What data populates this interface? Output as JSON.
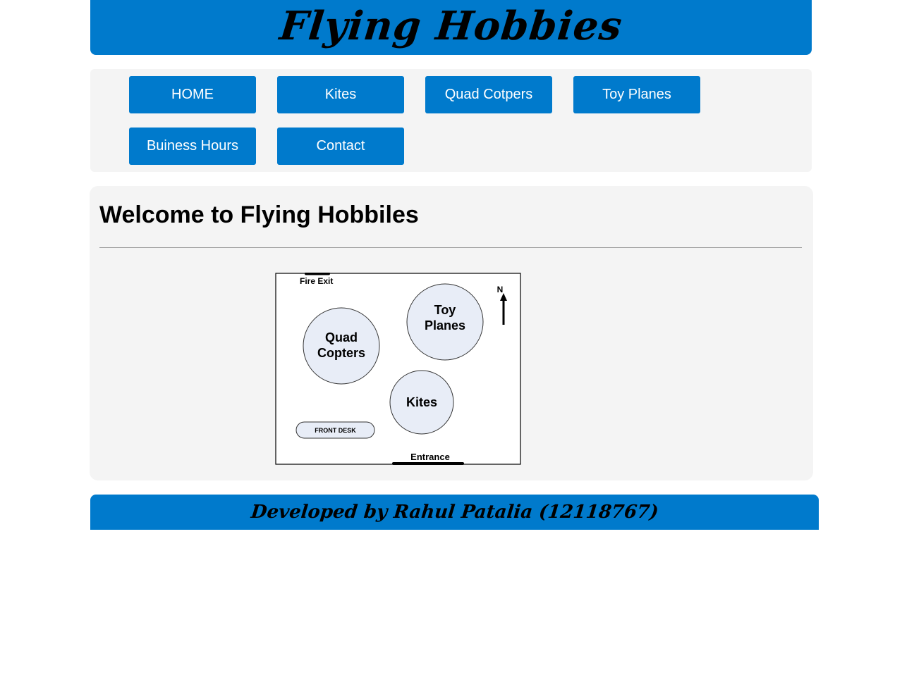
{
  "header": {
    "title": "Flying Hobbies"
  },
  "nav": {
    "items": [
      {
        "label": "HOME"
      },
      {
        "label": "Kites"
      },
      {
        "label": "Quad Cotpers"
      },
      {
        "label": "Toy Planes"
      },
      {
        "label": "Buiness Hours"
      },
      {
        "label": "Contact"
      }
    ]
  },
  "main": {
    "title": "Welcome to Flying Hobbiles",
    "map": {
      "fire_exit": "Fire Exit",
      "north": "N",
      "quad_line1": "Quad",
      "quad_line2": "Copters",
      "toy_line1": "Toy",
      "toy_line2": "Planes",
      "kites": "Kites",
      "front_desk": "FRONT DESK",
      "entrance": "Entrance"
    }
  },
  "footer": {
    "text": "Developed by Rahul Patalia (12118767)"
  },
  "colors": {
    "brand": "#007acc",
    "panel": "#f4f4f4",
    "map_circle": "#e8edf7"
  }
}
